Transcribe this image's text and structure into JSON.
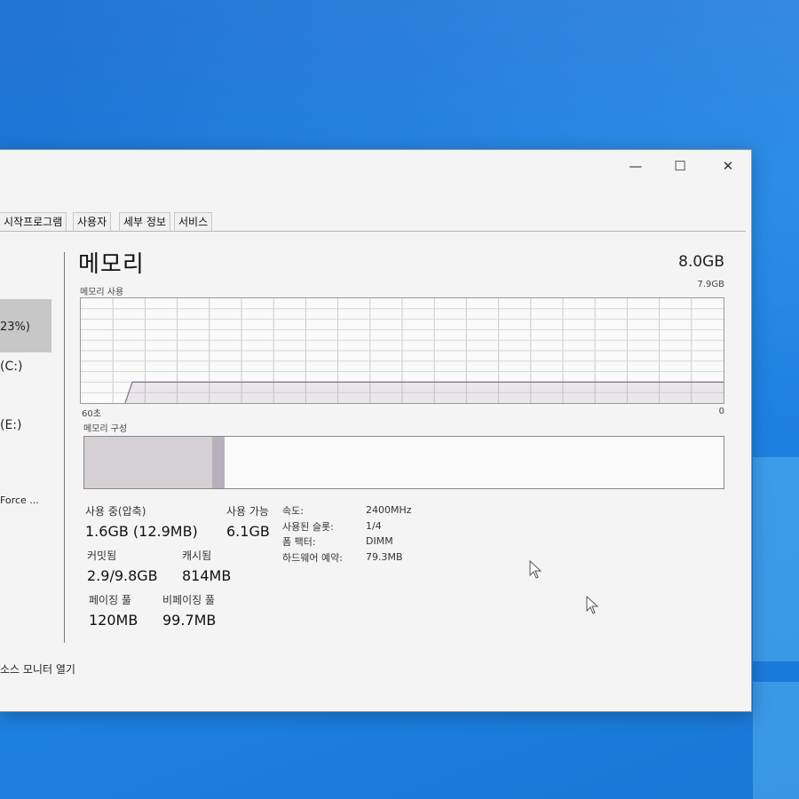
{
  "window": {
    "controls": {
      "minimize": "—",
      "maximize": "☐",
      "close": "✕"
    },
    "tabs": [
      "시작프로그램",
      "사용자",
      "세부 정보",
      "서비스"
    ]
  },
  "sidebar": {
    "items": [
      {
        "label": "23%)"
      },
      {
        "label": "(C:)"
      },
      {
        "label": "(E:)"
      },
      {
        "label": "Force ..."
      }
    ]
  },
  "memory": {
    "title": "메모리",
    "total": "8.0GB",
    "usage_label": "메모리 사용",
    "usage_max": "7.9GB",
    "time_left": "60초",
    "time_right": "0",
    "composition_label": "메모리 구성",
    "usage_fraction": 0.2,
    "composition": [
      {
        "name": "in-use",
        "fraction": 0.2,
        "color": "#d4d0d4"
      },
      {
        "name": "modified",
        "fraction": 0.02,
        "color": "#b8b0bc"
      },
      {
        "name": "standby",
        "fraction": 0.08,
        "color": "#fafafa"
      },
      {
        "name": "free",
        "fraction": 0.7,
        "color": "#fafafa"
      }
    ],
    "stats": {
      "in_use_label": "사용 중(압축)",
      "in_use_value": "1.6GB (12.9MB)",
      "available_label": "사용 가능",
      "available_value": "6.1GB",
      "committed_label": "커밋됨",
      "committed_value": "2.9/9.8GB",
      "cached_label": "캐시됨",
      "cached_value": "814MB",
      "paged_label": "페이징 풀",
      "paged_value": "120MB",
      "nonpaged_label": "비페이징 풀",
      "nonpaged_value": "99.7MB"
    },
    "props": {
      "speed_label": "속도:",
      "speed_value": "2400MHz",
      "slots_label": "사용된 슬롯:",
      "slots_value": "1/4",
      "form_label": "폼 팩터:",
      "form_value": "DIMM",
      "reserved_label": "하드웨어 예약:",
      "reserved_value": "79.3MB"
    }
  },
  "footer": {
    "resource_monitor": "소스 모니터 열기"
  }
}
